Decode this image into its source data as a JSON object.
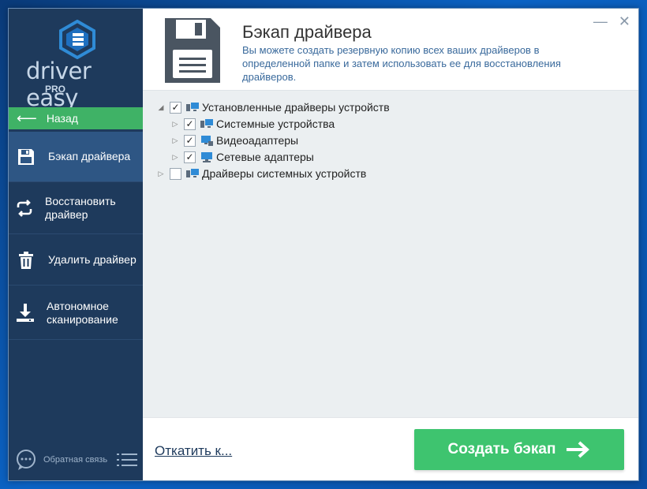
{
  "colors": {
    "sidebar": "#1e3a5c",
    "active": "#2e5684",
    "accent_green": "#3fb266",
    "button_green": "#3ec46f"
  },
  "sidebar": {
    "logo_text": "driver easy",
    "logo_badge": "PRO",
    "back_label": "Назад",
    "items": [
      {
        "label": "Бэкап драйвера",
        "icon": "floppy-disk-icon",
        "active": true
      },
      {
        "label": "Восстановить драйвер",
        "icon": "refresh-icon",
        "active": false
      },
      {
        "label": "Удалить драйвер",
        "icon": "trash-icon",
        "active": false
      },
      {
        "label": "Автономное сканирование",
        "icon": "download-scan-icon",
        "active": false
      }
    ],
    "feedback_label": "Обратная связь"
  },
  "header": {
    "title": "Бэкап драйвера",
    "description": "Вы можете создать резервную копию всех ваших драйверов в определенной папке и затем использовать ее для восстановления драйверов."
  },
  "tree": [
    {
      "label": "Установленные драйверы устройств",
      "checked": true,
      "expanded": true,
      "children": [
        {
          "label": "Системные устройства",
          "checked": true
        },
        {
          "label": "Видеоадаптеры",
          "checked": true
        },
        {
          "label": "Сетевые адаптеры",
          "checked": true
        }
      ]
    },
    {
      "label": "Драйверы системных устройств",
      "checked": false,
      "expanded": false,
      "children": []
    }
  ],
  "footer": {
    "rollback_link": "Откатить к...",
    "create_button": "Создать бэкап"
  }
}
